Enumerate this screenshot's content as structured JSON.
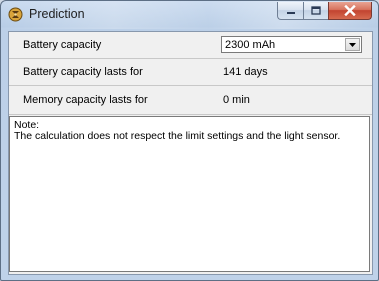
{
  "window": {
    "title": "Prediction",
    "app_icon": "hourglass-globe-icon",
    "caption_buttons": [
      "minimize-icon",
      "maximize-icon",
      "close-icon"
    ]
  },
  "rows": [
    {
      "label": "Battery capacity",
      "value": "2300 mAh",
      "type": "dropdown"
    },
    {
      "label": "Battery capacity lasts for",
      "value": "141 days",
      "type": "text"
    },
    {
      "label": "Memory capacity lasts for",
      "value": "0 min",
      "type": "text"
    }
  ],
  "note": {
    "heading": "Note:",
    "text": "The calculation does not respect the limit settings and the light sensor."
  }
}
